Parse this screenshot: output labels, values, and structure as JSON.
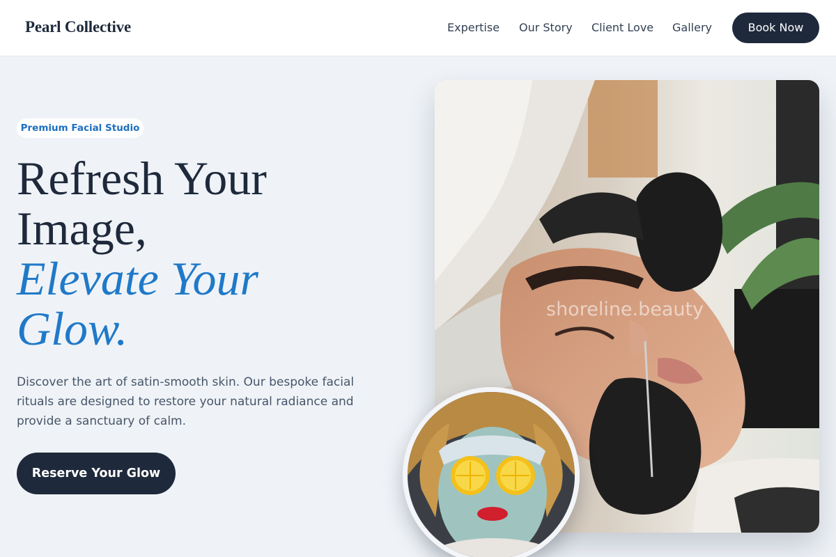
{
  "brand": {
    "name": "Pearl Collective"
  },
  "nav": {
    "links": [
      "Expertise",
      "Our Story",
      "Client Love",
      "Gallery"
    ],
    "cta_label": "Book Now"
  },
  "hero": {
    "badge": "Premium Facial Studio",
    "headline_line1": "Refresh Your",
    "headline_line2": "Image,",
    "headline_accent_line1": "Elevate Your",
    "headline_accent_line2": "Glow.",
    "description": "Discover the art of satin-smooth skin. Our bespoke facial rituals are designed to restore your natural radiance and provide a sanctuary of calm.",
    "cta_label": "Reserve Your Glow"
  },
  "images": {
    "main_photo": {
      "icon": "facial-extraction-photo",
      "watermark": "shoreline.beauty"
    },
    "round_photo": {
      "icon": "face-mask-lemon-photo"
    }
  },
  "colors": {
    "primary": "#1e293b",
    "accent": "#2079c8",
    "background": "#eff3f7"
  }
}
